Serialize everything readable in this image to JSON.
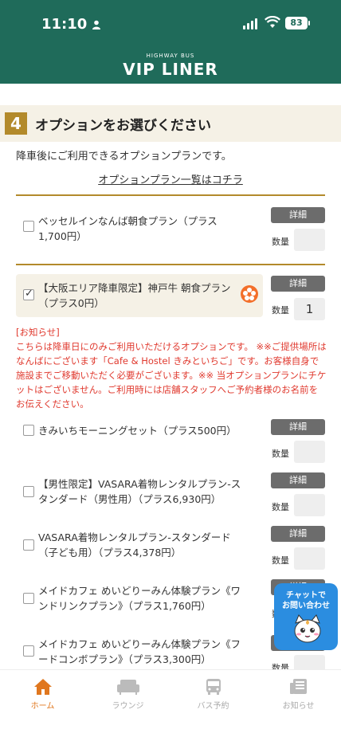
{
  "status_bar": {
    "time": "11:10",
    "battery": "83"
  },
  "app": {
    "logo_sub": "HIGHWAY BUS",
    "logo_main": "VIP LINER"
  },
  "section": {
    "step_number": "4",
    "title": "オプションをお選びください",
    "description": "降車後にご利用できるオプションプランです。",
    "list_link": "オプションプラン一覧はコチラ"
  },
  "detail_label": "詳細",
  "qty_label": "数量",
  "options": [
    {
      "label": "ベッセルインなんば朝食プラン（プラス1,700円）",
      "checked": false,
      "qty": ""
    },
    {
      "label": "【大阪エリア降車限定】神戸牛 朝食プラン（プラス0円）",
      "checked": true,
      "qty": "1"
    },
    {
      "label": "きみいちモーニングセット（プラス500円）",
      "checked": false,
      "qty": ""
    },
    {
      "label": "【男性限定】VASARA着物レンタルプラン-スタンダード（男性用）（プラス6,930円）",
      "checked": false,
      "qty": ""
    },
    {
      "label": "VASARA着物レンタルプラン-スタンダード（子ども用）（プラス4,378円）",
      "checked": false,
      "qty": ""
    },
    {
      "label": "メイドカフェ めいどりーみん体験プラン《ワンドリンクプラン》（プラス1,760円）",
      "checked": false,
      "qty": ""
    },
    {
      "label": "メイドカフェ めいどりーみん体験プラン《フードコンボプラン》（プラス3,300円）",
      "checked": false,
      "qty": ""
    }
  ],
  "notice": {
    "heading": "[お知らせ]",
    "body": "こちらは降車日にのみご利用いただけるオプションです。 ※※ご提供場所はなんばにございます「Cafe & Hostel きみといちご」です。お客様自身で施設までご移動いただく必要がございます。※※ 当オプションプランにチケットはございません。ご利用時には店舗スタッフへご予約者様のお名前をお伝えください。"
  },
  "chat": {
    "line1": "チャットで",
    "line2": "お問い合わせ"
  },
  "nav": [
    {
      "label": "ホーム",
      "icon": "home-icon",
      "active": true
    },
    {
      "label": "ラウンジ",
      "icon": "sofa-icon",
      "active": false
    },
    {
      "label": "バス予約",
      "icon": "bus-icon",
      "active": false
    },
    {
      "label": "お知らせ",
      "icon": "news-icon",
      "active": false
    }
  ],
  "colors": {
    "header": "#1f6b5a",
    "gold": "#b38a2b",
    "notice": "#e03a2f",
    "active_nav": "#e0771e",
    "chat": "#2b8de0"
  }
}
